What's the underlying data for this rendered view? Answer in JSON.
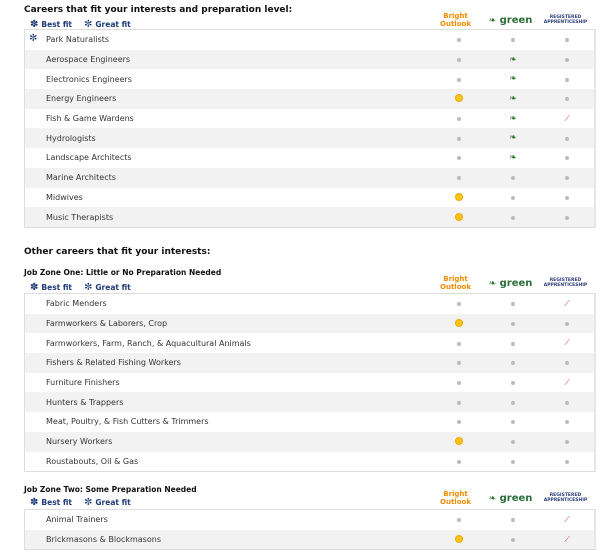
{
  "legend": {
    "best": "Best fit",
    "great": "Great fit"
  },
  "logos": {
    "bright": "Bright Outlook",
    "green": "green",
    "apprentice": "REGISTERED APPRENTICESHIP"
  },
  "sections": [
    {
      "title": "Careers that fit your interests and preparation level:",
      "subtitle": "",
      "rows": [
        {
          "name": "Park Naturalists",
          "fit": "great",
          "b": 0,
          "g": 0,
          "a": 0
        },
        {
          "name": "Aerospace Engineers",
          "b": 0,
          "g": 1,
          "a": 0
        },
        {
          "name": "Electronics Engineers",
          "b": 0,
          "g": 1,
          "a": 0
        },
        {
          "name": "Energy Engineers",
          "b": 1,
          "g": 1,
          "a": 0
        },
        {
          "name": "Fish & Game Wardens",
          "b": 0,
          "g": 1,
          "a": 1
        },
        {
          "name": "Hydrologists",
          "b": 0,
          "g": 1,
          "a": 0
        },
        {
          "name": "Landscape Architects",
          "b": 0,
          "g": 1,
          "a": 0
        },
        {
          "name": "Marine Architects",
          "b": 0,
          "g": 0,
          "a": 0
        },
        {
          "name": "Midwives",
          "b": 1,
          "g": 0,
          "a": 0
        },
        {
          "name": "Music Therapists",
          "b": 1,
          "g": 0,
          "a": 0
        }
      ]
    },
    {
      "title": "Other careers that fit your interests:",
      "subtitle": "Job Zone One: Little or No Preparation Needed",
      "rows": [
        {
          "name": "Fabric Menders",
          "b": 0,
          "g": 0,
          "a": 1
        },
        {
          "name": "Farmworkers & Laborers, Crop",
          "b": 1,
          "g": 0,
          "a": 0
        },
        {
          "name": "Farmworkers, Farm, Ranch, & Aquacultural Animals",
          "b": 0,
          "g": 0,
          "a": 1
        },
        {
          "name": "Fishers & Related Fishing Workers",
          "b": 0,
          "g": 0,
          "a": 0
        },
        {
          "name": "Furniture Finishers",
          "b": 0,
          "g": 0,
          "a": 1
        },
        {
          "name": "Hunters & Trappers",
          "b": 0,
          "g": 0,
          "a": 0
        },
        {
          "name": "Meat, Poultry, & Fish Cutters & Trimmers",
          "b": 0,
          "g": 0,
          "a": 0
        },
        {
          "name": "Nursery Workers",
          "b": 1,
          "g": 0,
          "a": 0
        },
        {
          "name": "Roustabouts, Oil & Gas",
          "b": 0,
          "g": 0,
          "a": 0
        }
      ]
    },
    {
      "title": "",
      "subtitle": "Job Zone Two: Some Preparation Needed",
      "rows": [
        {
          "name": "Animal Trainers",
          "b": 0,
          "g": 0,
          "a": 1
        },
        {
          "name": "Brickmasons & Blockmasons",
          "b": 1,
          "g": 0,
          "a": 1
        }
      ]
    }
  ]
}
